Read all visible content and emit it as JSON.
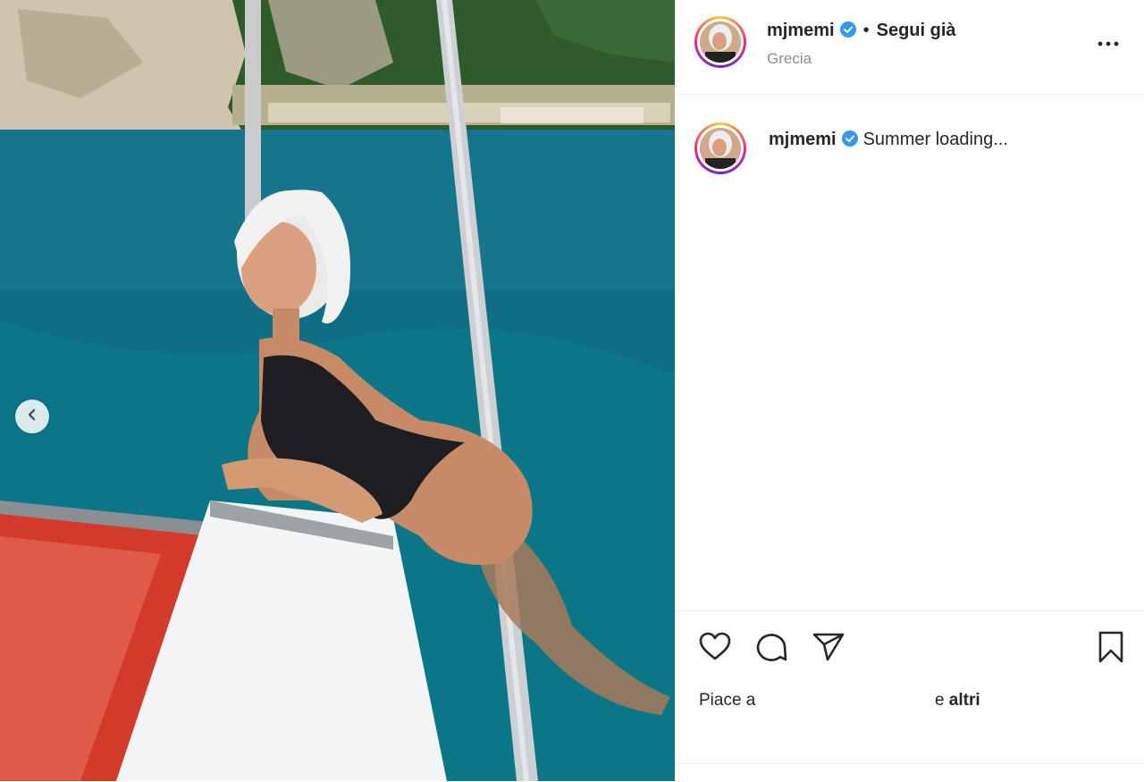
{
  "post": {
    "username": "mjmemi",
    "follow_label": "Segui già",
    "separator": "•",
    "location": "Grecia",
    "caption": "Summer loading...",
    "likes_prefix": "Piace a",
    "likes_middle": "e",
    "likes_others": "altri"
  },
  "icons": {
    "verified": "verified-badge-icon",
    "more": "more-options-icon",
    "like": "heart-icon",
    "comment": "comment-icon",
    "share": "share-icon",
    "save": "bookmark-icon",
    "prev": "chevron-left-icon"
  },
  "colors": {
    "verified_blue": "#3897f0",
    "text": "#262626",
    "muted": "#8e8e8e"
  }
}
